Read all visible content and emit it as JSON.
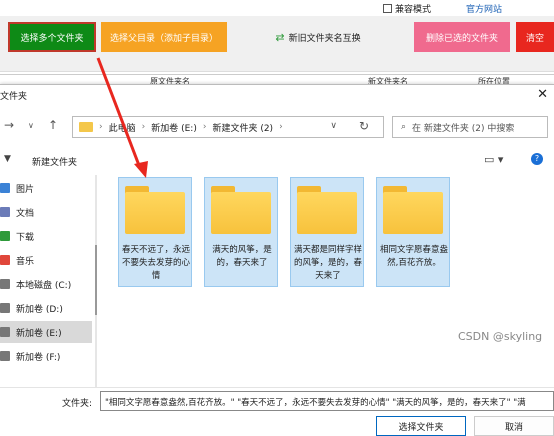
{
  "app": {
    "compat_label": "兼容模式",
    "site_link": "官方网站",
    "buttons": {
      "select_folders": "选择多个文件夹",
      "select_parent": "选择父目录（添加子目录）",
      "swap": "新旧文件夹名互换",
      "delete_selected": "删除已选的文件夹",
      "clear": "清空"
    },
    "table_headers": [
      "原文件夹名",
      "新文件夹名",
      "所在位置"
    ]
  },
  "dialog": {
    "title": "文件夹",
    "breadcrumb": [
      "此电脑",
      "新加卷 (E:)",
      "新建文件夹 (2)"
    ],
    "search_placeholder": "在 新建文件夹 (2) 中搜索",
    "new_folder": "新建文件夹",
    "sidebar": [
      {
        "label": "图片",
        "color": "#3b82d6"
      },
      {
        "label": "文档",
        "color": "#6b7bb8"
      },
      {
        "label": "下载",
        "color": "#2e9a3a"
      },
      {
        "label": "音乐",
        "color": "#e0463a"
      },
      {
        "label": "本地磁盘 (C:)",
        "color": "#777777"
      },
      {
        "label": "新加卷 (D:)",
        "color": "#777777"
      },
      {
        "label": "新加卷 (E:)",
        "color": "#777777"
      },
      {
        "label": "新加卷 (F:)",
        "color": "#777777"
      }
    ],
    "folders": [
      {
        "name": "春天不远了，永远不要失去发芽的心情"
      },
      {
        "name": "满天的风筝，是的，春天来了"
      },
      {
        "name": "满天都是同样字样的风筝，是的，春天来了"
      },
      {
        "name": "相同文字愿春意盎然,百花齐放。"
      }
    ],
    "filename_label": "文件夹:",
    "filename_value": "\"相同文字愿春意盎然,百花齐放。\" \"春天不远了，永远不要失去发芽的心情\" \"满天的风筝，是的，春天来了\" \"满",
    "select_button": "选择文件夹",
    "cancel_button": "取消"
  },
  "watermark": "CSDN @skyling"
}
